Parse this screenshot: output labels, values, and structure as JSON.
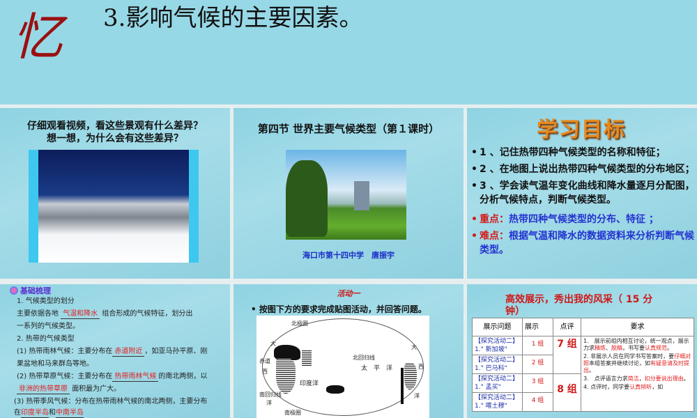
{
  "slide_top": {
    "char": "忆",
    "title": "3.影响气候的主要因素。"
  },
  "slide_video": {
    "question_line1": "仔细观看视频，看这些景观有什么差异？",
    "question_line2": "想一想，为什么会有这些差异？"
  },
  "slide_cover": {
    "title": "第四节 世界主要气候类型（第１课时）",
    "author": "海口市第十四中学　唐振宇"
  },
  "slide_goals": {
    "heading": "学习目标",
    "items": [
      "1 、记住热带四种气候类型的名称和特征；",
      "2 、在地图上说出热带四种气候类型的分布地区；",
      "3 、学会读气温年变化曲线和降水量逐月分配图，分析气候特点，判断气候类型。"
    ],
    "key_label": "重点：",
    "key_text": "热带四种气候类型的分布、特征 ；",
    "hard_label": "难点：",
    "hard_text": "根据气温和降水的数据资料来分析判断气候类型。"
  },
  "slide_review": {
    "tag": "基础梳理",
    "l1": "1. 气候类型的划分",
    "l2a": "主要依据各地",
    "f1": "气温和降水",
    "l2b": "组合形成的气候特征，划分出",
    "l3": "一系列的气候类型。",
    "l4": "2. 热带的气候类型",
    "l5a": "(1) 热带雨林气候：主要分布在",
    "f2": "赤道附近",
    "l5b": "，如亚马孙平原、刚",
    "l6": "果盆地和马来群岛等地。",
    "l7a": "(2) 热带草原气候：主要分布在",
    "f3": "热带雨林气候",
    "l7b": "的南北两侧，以",
    "f4": "非洲的热带草原",
    "l8": "面积最为广大。",
    "l9": "(3) 热带季风气候：分布在热带雨林气候的南北两侧，主要分布",
    "l10a": "在",
    "f5": "印度半岛",
    "l10b": "和",
    "f6": "中南半岛"
  },
  "slide_activity": {
    "title": "活动一",
    "instruction": "按图下方的要求完成贴图活动，并回答问题。",
    "map_labels": {
      "n_tropic": "北回归线",
      "s_tropic": "南回归线",
      "equator": "赤道",
      "pacific": "太　平　洋",
      "indian": "印度洋",
      "atl_1": "大",
      "atl_2": "西",
      "atl_3": "洋",
      "atl_4": "大",
      "atl_5": "西",
      "atl_6": "洋",
      "arctic": "北极圈",
      "antarctic": "南极圈"
    }
  },
  "slide_show": {
    "title": "高效展示，秀出我的风采（ 15 分钟）",
    "headers": [
      "展示问题",
      "展示",
      "点评",
      "要求"
    ],
    "rows": [
      {
        "q1": "【探究活动二】",
        "q2": "1.\" 新加坡\"",
        "group": "1 组"
      },
      {
        "q1": "【探究活动二】",
        "q2": "1.\" 巴马科\"",
        "group": "2 组"
      },
      {
        "q1": "【探究活动二】",
        "q2": "1.\" 孟买\"",
        "group": "3 组"
      },
      {
        "q1": "【探究活动二】",
        "q2": "1.\" 喀土穆\"",
        "group": "4 组"
      }
    ],
    "review_a": "7 组",
    "review_b": "8 组",
    "req1a": "1.　展示前组内相互讨论，统一观点，展示力求",
    "req1r1": "精炼",
    "req1b": "、",
    "req1r2": "脱稿",
    "req1c": "，书写要",
    "req1r3": "认真规范",
    "req1d": "。",
    "req2a": "2. 非展示人员在同学书写答案时，要",
    "req2r1": "仔细对照",
    "req2b": "本组答案并继续讨论，如",
    "req2r2": "有疑意请及时提出",
    "req2c": "。",
    "req3a": "3.　点评语言力求",
    "req3r1": "简洁",
    "req3b": "，",
    "req3r2": "扣分要说出理由",
    "req3c": "。",
    "req4a": "4. 点评时，同学要",
    "req4r1": "认真倾听",
    "req4b": "，如"
  }
}
